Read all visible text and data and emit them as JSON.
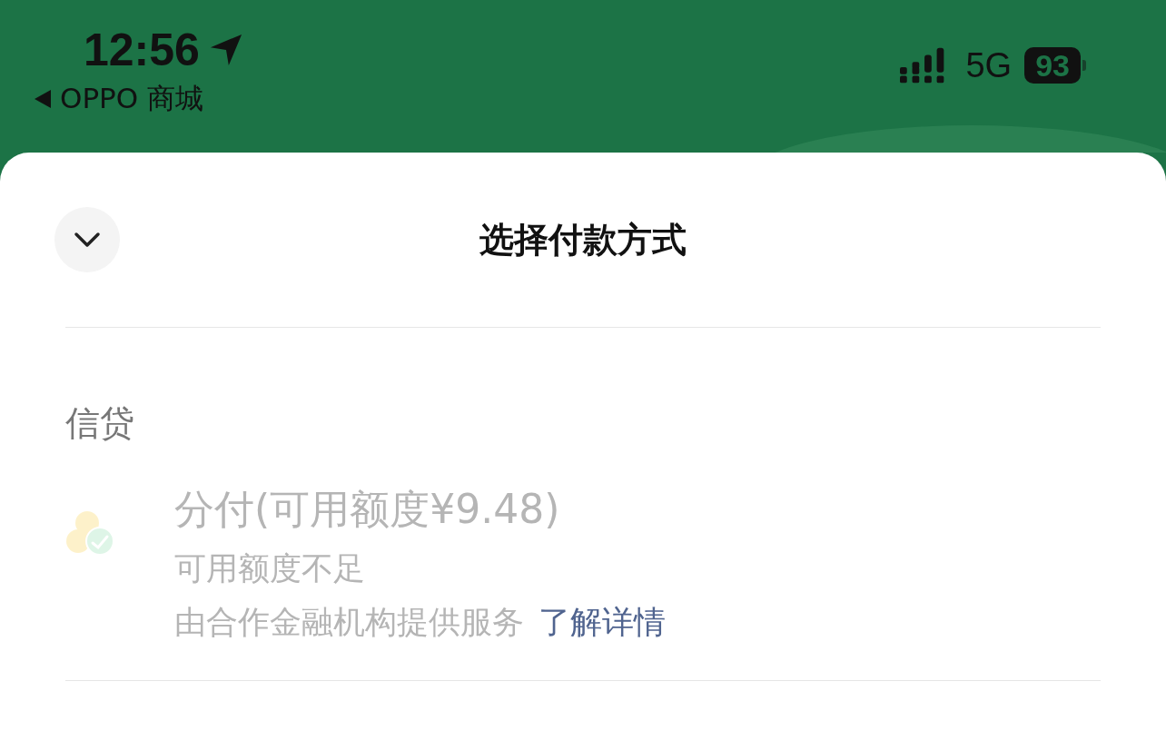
{
  "status_bar": {
    "time": "12:56",
    "back_app": "OPPO 商城",
    "network": "5G",
    "battery": "93"
  },
  "sheet": {
    "title": "选择付款方式"
  },
  "sections": [
    {
      "label": "信贷",
      "options": [
        {
          "title": "分付(可用额度¥9.48)",
          "subtitle": "可用额度不足",
          "provider": "由合作金融机构提供服务",
          "link": "了解详情",
          "disabled": true
        }
      ]
    }
  ]
}
